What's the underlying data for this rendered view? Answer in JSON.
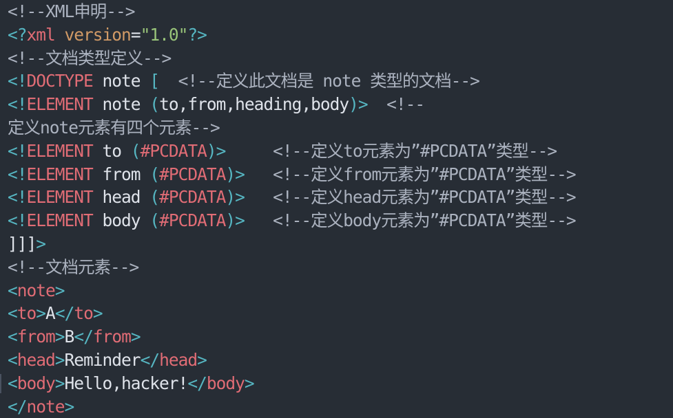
{
  "editor": {
    "language": "XML",
    "theme_colors": {
      "background": "#272d35",
      "comment": "#abb2bf",
      "tag": "#e06c75",
      "attribute": "#d19a66",
      "string": "#98c379",
      "bracket": "#56b6c2",
      "text": "#dfe3ea"
    },
    "lines": [
      {
        "tokens": [
          {
            "t": "<!--XML申明-->",
            "c": "comment"
          }
        ]
      },
      {
        "tokens": [
          {
            "t": "<?",
            "c": "bracket"
          },
          {
            "t": "xml",
            "c": "tag"
          },
          {
            "t": " ",
            "c": "text"
          },
          {
            "t": "version",
            "c": "attr"
          },
          {
            "t": "=",
            "c": "text"
          },
          {
            "t": "\"1.0\"",
            "c": "string"
          },
          {
            "t": "?>",
            "c": "bracket"
          }
        ]
      },
      {
        "tokens": [
          {
            "t": "<!--文档类型定义-->",
            "c": "comment"
          }
        ]
      },
      {
        "tokens": [
          {
            "t": "<!",
            "c": "bracket"
          },
          {
            "t": "DOCTYPE",
            "c": "tag"
          },
          {
            "t": " note ",
            "c": "text"
          },
          {
            "t": "[",
            "c": "bracket"
          },
          {
            "t": "  <!--定义此文档是 note 类型的文档-->",
            "c": "comment"
          }
        ]
      },
      {
        "tokens": [
          {
            "t": "<!",
            "c": "bracket"
          },
          {
            "t": "ELEMENT",
            "c": "tag"
          },
          {
            "t": " note ",
            "c": "text"
          },
          {
            "t": "(",
            "c": "bracket"
          },
          {
            "t": "to,from,heading,body",
            "c": "text"
          },
          {
            "t": ")>",
            "c": "bracket"
          },
          {
            "t": "  <!--",
            "c": "comment"
          }
        ]
      },
      {
        "tokens": [
          {
            "t": "定义note元素有四个元素-->",
            "c": "comment"
          }
        ]
      },
      {
        "tokens": [
          {
            "t": "<!",
            "c": "bracket"
          },
          {
            "t": "ELEMENT",
            "c": "tag"
          },
          {
            "t": " to ",
            "c": "text"
          },
          {
            "t": "(",
            "c": "bracket"
          },
          {
            "t": "#PCDATA",
            "c": "tag"
          },
          {
            "t": ")>",
            "c": "bracket"
          },
          {
            "t": "     <!--定义to元素为”#PCDATA”类型-->",
            "c": "comment"
          }
        ]
      },
      {
        "tokens": [
          {
            "t": "<!",
            "c": "bracket"
          },
          {
            "t": "ELEMENT",
            "c": "tag"
          },
          {
            "t": " from ",
            "c": "text"
          },
          {
            "t": "(",
            "c": "bracket"
          },
          {
            "t": "#PCDATA",
            "c": "tag"
          },
          {
            "t": ")>",
            "c": "bracket"
          },
          {
            "t": "   <!--定义from元素为”#PCDATA”类型-->",
            "c": "comment"
          }
        ]
      },
      {
        "tokens": [
          {
            "t": "<!",
            "c": "bracket"
          },
          {
            "t": "ELEMENT",
            "c": "tag"
          },
          {
            "t": " head ",
            "c": "text"
          },
          {
            "t": "(",
            "c": "bracket"
          },
          {
            "t": "#PCDATA",
            "c": "tag"
          },
          {
            "t": ")>",
            "c": "bracket"
          },
          {
            "t": "   <!--定义head元素为”#PCDATA”类型-->",
            "c": "comment"
          }
        ]
      },
      {
        "tokens": [
          {
            "t": "<!",
            "c": "bracket"
          },
          {
            "t": "ELEMENT",
            "c": "tag"
          },
          {
            "t": " body ",
            "c": "text"
          },
          {
            "t": "(",
            "c": "bracket"
          },
          {
            "t": "#PCDATA",
            "c": "tag"
          },
          {
            "t": ")>",
            "c": "bracket"
          },
          {
            "t": "   <!--定义body元素为”#PCDATA”类型-->",
            "c": "comment"
          }
        ]
      },
      {
        "tokens": [
          {
            "t": "]]]",
            "c": "text"
          },
          {
            "t": ">",
            "c": "bracket"
          }
        ]
      },
      {
        "tokens": [
          {
            "t": "<!--文档元素-->",
            "c": "comment"
          }
        ]
      },
      {
        "tokens": [
          {
            "t": "<",
            "c": "bracket"
          },
          {
            "t": "note",
            "c": "tag"
          },
          {
            "t": ">",
            "c": "bracket"
          }
        ]
      },
      {
        "tokens": [
          {
            "t": "<",
            "c": "bracket"
          },
          {
            "t": "to",
            "c": "tag"
          },
          {
            "t": ">",
            "c": "bracket"
          },
          {
            "t": "A",
            "c": "text"
          },
          {
            "t": "</",
            "c": "bracket"
          },
          {
            "t": "to",
            "c": "tag"
          },
          {
            "t": ">",
            "c": "bracket"
          }
        ]
      },
      {
        "tokens": [
          {
            "t": "<",
            "c": "bracket"
          },
          {
            "t": "from",
            "c": "tag"
          },
          {
            "t": ">",
            "c": "bracket"
          },
          {
            "t": "B",
            "c": "text"
          },
          {
            "t": "</",
            "c": "bracket"
          },
          {
            "t": "from",
            "c": "tag"
          },
          {
            "t": ">",
            "c": "bracket"
          }
        ]
      },
      {
        "tokens": [
          {
            "t": "<",
            "c": "bracket"
          },
          {
            "t": "head",
            "c": "tag"
          },
          {
            "t": ">",
            "c": "bracket"
          },
          {
            "t": "Reminder",
            "c": "text"
          },
          {
            "t": "</",
            "c": "bracket"
          },
          {
            "t": "head",
            "c": "tag"
          },
          {
            "t": ">",
            "c": "bracket"
          }
        ]
      },
      {
        "cursor": true,
        "tokens": [
          {
            "t": "<",
            "c": "bracket"
          },
          {
            "t": "body",
            "c": "tag"
          },
          {
            "t": ">",
            "c": "bracket"
          },
          {
            "t": "Hello,hacker!",
            "c": "text"
          },
          {
            "t": "</",
            "c": "bracket"
          },
          {
            "t": "body",
            "c": "tag"
          },
          {
            "t": ">",
            "c": "bracket"
          }
        ]
      },
      {
        "tokens": [
          {
            "t": "</",
            "c": "bracket"
          },
          {
            "t": "note",
            "c": "tag"
          },
          {
            "t": ">",
            "c": "bracket"
          }
        ]
      }
    ]
  }
}
